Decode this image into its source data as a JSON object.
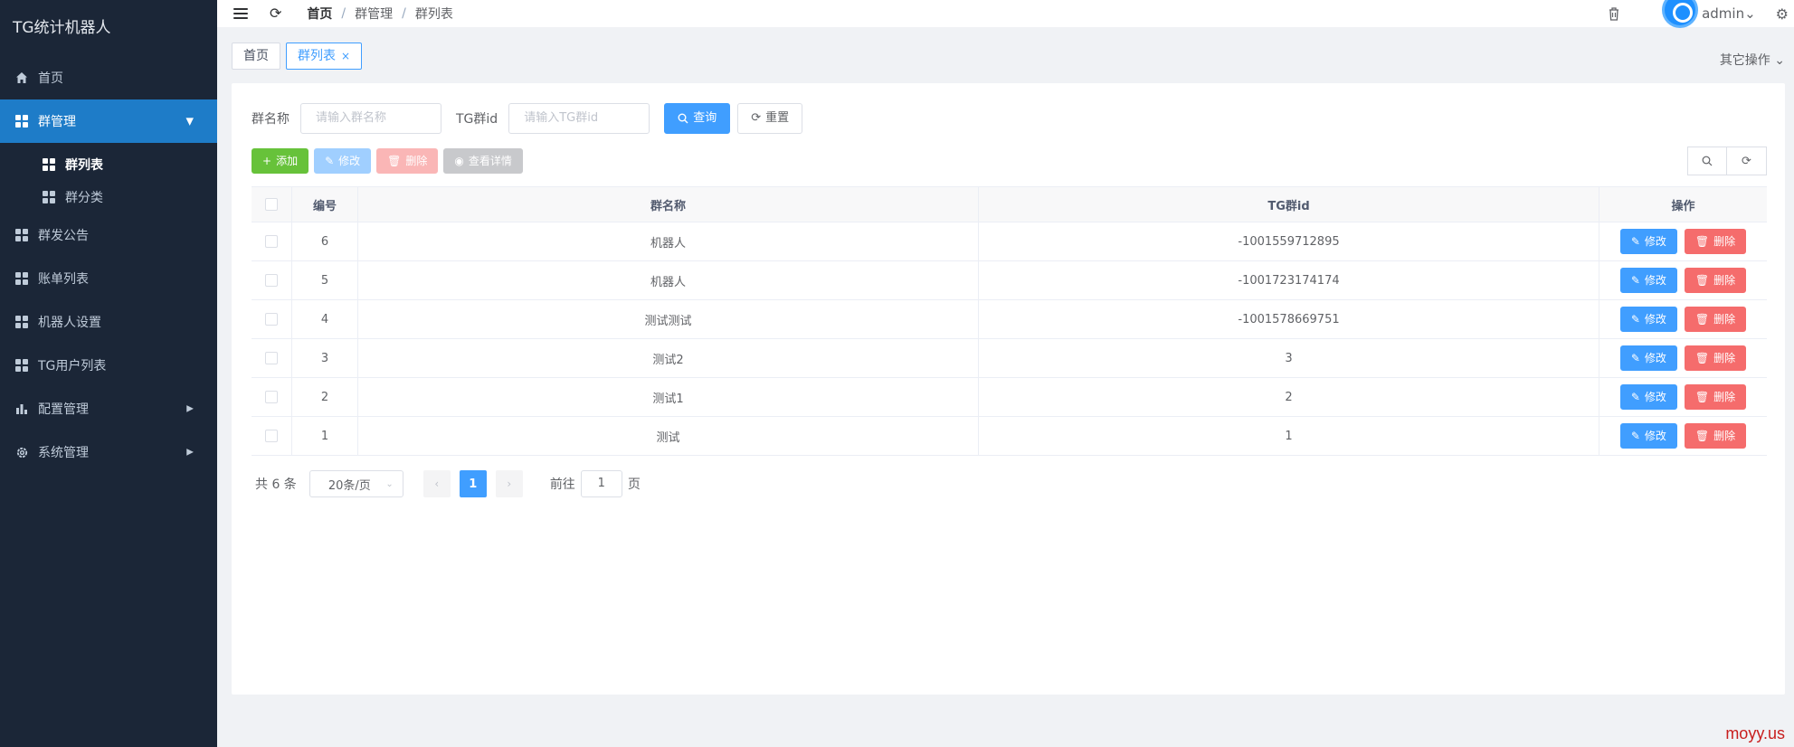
{
  "app": {
    "title": "TG统计机器人"
  },
  "sidebar": {
    "items": [
      {
        "label": "首页",
        "icon": "home-icon"
      },
      {
        "label": "群管理",
        "icon": "grid-icon",
        "active": true,
        "children": [
          {
            "label": "群列表",
            "active": true
          },
          {
            "label": "群分类"
          }
        ]
      },
      {
        "label": "群发公告",
        "icon": "grid-icon"
      },
      {
        "label": "账单列表",
        "icon": "grid-icon"
      },
      {
        "label": "机器人设置",
        "icon": "grid-icon"
      },
      {
        "label": "TG用户列表",
        "icon": "grid-icon"
      },
      {
        "label": "配置管理",
        "icon": "bar-chart-icon"
      },
      {
        "label": "系统管理",
        "icon": "gear-icon"
      }
    ]
  },
  "header": {
    "breadcrumb": [
      "首页",
      "群管理",
      "群列表"
    ],
    "user": "admin"
  },
  "tags": {
    "items": [
      {
        "label": "首页"
      },
      {
        "label": "群列表",
        "active": true
      }
    ],
    "other_ops": "其它操作"
  },
  "search": {
    "name_label": "群名称",
    "name_placeholder": "请输入群名称",
    "tg_label": "TG群id",
    "tg_placeholder": "请输入TG群id",
    "query_btn": "查询",
    "reset_btn": "重置"
  },
  "toolbar": {
    "add": "添加",
    "edit": "修改",
    "delete": "删除",
    "view": "查看详情"
  },
  "table": {
    "headers": [
      "编号",
      "群名称",
      "TG群id",
      "操作"
    ],
    "rows": [
      {
        "no": "6",
        "name": "机器人",
        "tgid": "-1001559712895"
      },
      {
        "no": "5",
        "name": "机器人",
        "tgid": "-1001723174174"
      },
      {
        "no": "4",
        "name": "测试测试",
        "tgid": "-1001578669751"
      },
      {
        "no": "3",
        "name": "测试2",
        "tgid": "3"
      },
      {
        "no": "2",
        "name": "测试1",
        "tgid": "2"
      },
      {
        "no": "1",
        "name": "测试",
        "tgid": "1"
      }
    ],
    "row_edit": "修改",
    "row_delete": "删除"
  },
  "pagination": {
    "total": "共 6 条",
    "page_size": "20条/页",
    "current": "1",
    "goto_prefix": "前往",
    "goto_value": "1",
    "goto_suffix": "页"
  },
  "watermark": "moyy.us",
  "colors": {
    "sidebar_bg": "#1b2637",
    "sidebar_active": "#1e7cc8",
    "primary": "#409eff",
    "success": "#67c23a",
    "danger": "#f56c6c"
  }
}
